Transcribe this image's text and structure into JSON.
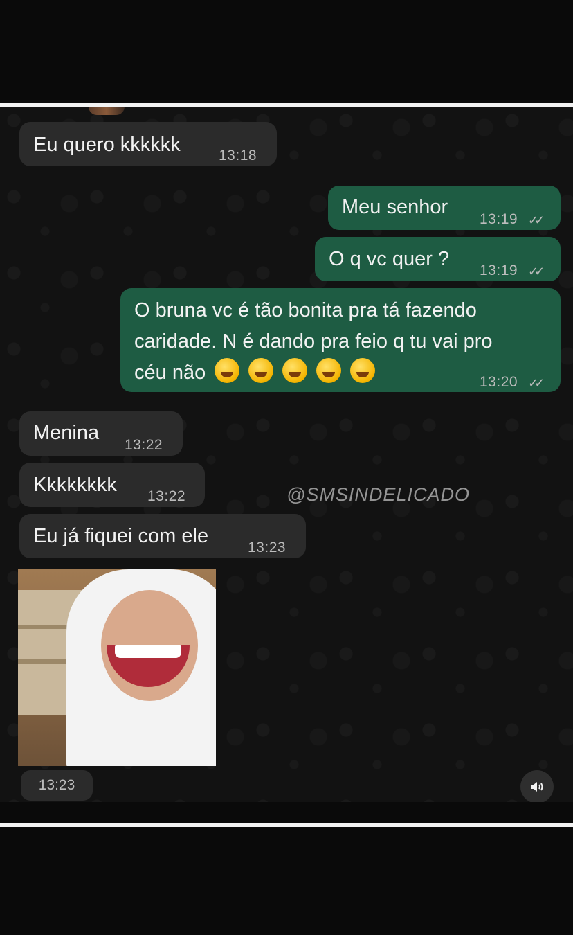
{
  "messages": [
    {
      "text": "Eu quero kkkkkk",
      "time": "13:18",
      "dir": "in"
    },
    {
      "text": "Meu senhor",
      "time": "13:19",
      "dir": "out",
      "ticks": "✓✓"
    },
    {
      "text": "O q vc quer ?",
      "time": "13:19",
      "dir": "out",
      "ticks": "✓✓"
    },
    {
      "line1": "O bruna vc é tão bonita pra tá fazendo",
      "line2": "caridade. N é dando pra feio q tu vai pro",
      "line3": "céu não",
      "emoji_name": "rolling-on-floor-laughing",
      "time": "13:20",
      "dir": "out",
      "ticks": "✓✓"
    },
    {
      "text": "Menina",
      "time": "13:22",
      "dir": "in"
    },
    {
      "text": "Kkkkkkkk",
      "time": "13:22",
      "dir": "in"
    },
    {
      "text": "Eu já fiquei com ele",
      "time": "13:23",
      "dir": "in"
    }
  ],
  "media": {
    "time": "13:23",
    "sound_icon": "speaker-icon"
  },
  "watermark": "@SMSINDELICADO",
  "colors": {
    "incoming": "#2b2b2b",
    "outgoing": "#1e5c43",
    "background": "#121212"
  }
}
